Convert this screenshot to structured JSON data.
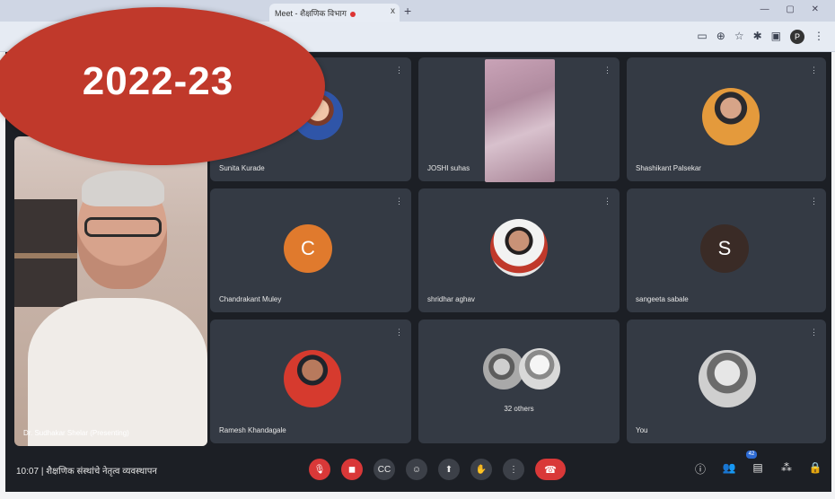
{
  "browser": {
    "tab_title": "Meet - शैक्षणिक विभाग",
    "tab_close": "x",
    "new_tab": "+",
    "window_controls": "— ▢ ✕",
    "toolbar_icons": [
      "cast-icon",
      "bookmark-icon",
      "star-icon",
      "extensions-icon",
      "sidebar-icon"
    ],
    "profile_initial": "P"
  },
  "stamp": {
    "text": "2022-23",
    "color": "#c0392b"
  },
  "participants": [
    {
      "name": "Sunita Kurade",
      "avatar": "photo"
    },
    {
      "name": "JOSHI suhas",
      "avatar": "video"
    },
    {
      "name": "Shashikant Palsekar",
      "avatar": "photo"
    },
    {
      "name": "Chandrakant Muley",
      "avatar": "letter",
      "letter": "C",
      "color": "#e07a2d"
    },
    {
      "name": "shridhar aghav",
      "avatar": "photo"
    },
    {
      "name": "sangeeta sabale",
      "avatar": "letter",
      "letter": "S",
      "color": "#3a2b26"
    },
    {
      "name": "Ramesh Khandagale",
      "avatar": "photo"
    },
    {
      "name": "32 others",
      "avatar": "group"
    },
    {
      "name": "You",
      "avatar": "photo"
    }
  ],
  "self_view": {
    "name": "Dr. Sudhakar Shelar (Presenting)"
  },
  "bottom_bar": {
    "time": "10:07",
    "separator": "|",
    "meeting_title": "शैक्षणिक संस्थांचे नेतृत्व व्यवस्थापन",
    "participants_badge": "42",
    "controls": [
      "mic-off-icon",
      "camera-off-icon",
      "captions-icon",
      "emoji-icon",
      "present-icon",
      "raise-hand-icon",
      "more-options-icon"
    ],
    "right_controls": [
      "info-icon",
      "people-icon",
      "chat-icon",
      "activities-icon",
      "host-controls-icon"
    ]
  }
}
